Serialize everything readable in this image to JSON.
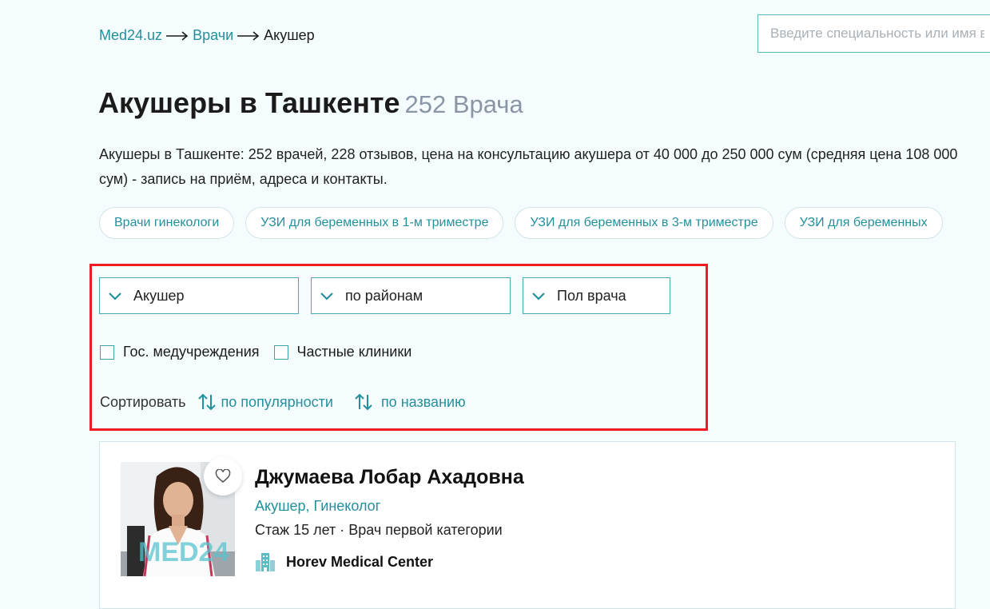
{
  "breadcrumb": {
    "items": [
      "Med24.uz",
      "Врачи",
      "Акушер"
    ]
  },
  "search": {
    "placeholder": "Введите специальность или имя врача"
  },
  "page": {
    "title": "Акушеры в Ташкенте",
    "count": "252 Врача",
    "description": "Акушеры в Ташкенте: 252 врачей, 228 отзывов, цена на консультацию акушера от 40 000 до 250 000 сум (средняя цена 108 000 сум) - запись на приём, адреса и контакты."
  },
  "tags": [
    "Врачи гинекологи",
    "УЗИ для беременных в 1-м триместре",
    "УЗИ для беременных в 3-м триместре",
    "УЗИ для беременных"
  ],
  "filters": {
    "specialty": "Акушер",
    "district": "по районам",
    "gender": "Пол врача",
    "checkboxes": [
      "Гос. медучреждения",
      "Частные клиники"
    ],
    "sort_label": "Сортировать",
    "sort_options": [
      "по популярности",
      "по названию"
    ]
  },
  "doctor": {
    "name": "Джумаева Лобар Ахадовна",
    "specialty": "Акушер, Гинеколог",
    "experience": "Стаж 15 лет · Врач первой категории",
    "clinic": "Horev Medical Center",
    "photo_watermark": "MED24"
  },
  "colors": {
    "accent": "#23909e",
    "border": "#45aab5",
    "highlight": "#ee1c25",
    "background": "#f5fcfd"
  },
  "icons": [
    "arrow-right-icon",
    "chevron-down-icon",
    "sort-arrows-icon",
    "heart-icon",
    "building-icon"
  ]
}
